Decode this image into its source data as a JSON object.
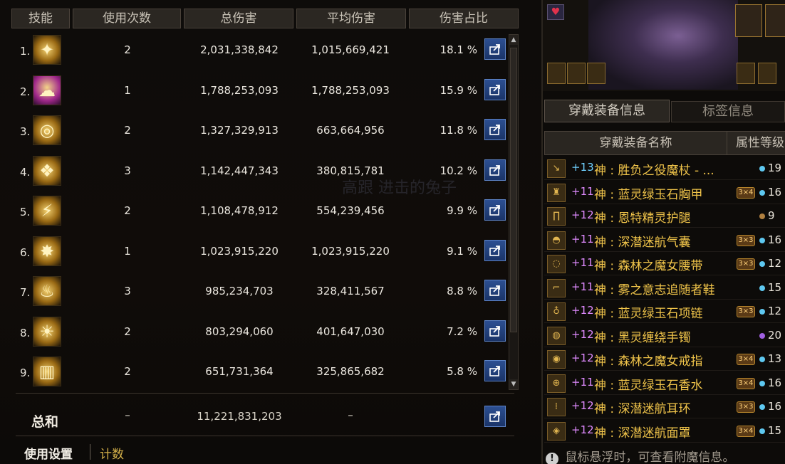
{
  "headers": {
    "skill": "技能",
    "uses": "使用次数",
    "total": "总伤害",
    "avg": "平均伤害",
    "pct": "伤害占比"
  },
  "rows": [
    {
      "num": "1.",
      "uses": "2",
      "total": "2,031,338,842",
      "avg": "1,015,669,421",
      "pct": "18.1 %",
      "icon": "golden-spikes-skill-icon"
    },
    {
      "num": "2.",
      "uses": "1",
      "total": "1,788,253,093",
      "avg": "1,788,253,093",
      "pct": "15.9 %",
      "icon": "purple-burst-skill-icon"
    },
    {
      "num": "3.",
      "uses": "2",
      "total": "1,327,329,913",
      "avg": "663,664,956",
      "pct": "11.8 %",
      "icon": "swirl-skill-icon"
    },
    {
      "num": "4.",
      "uses": "3",
      "total": "1,142,447,343",
      "avg": "380,815,781",
      "pct": "10.2 %",
      "icon": "crystal-skill-icon"
    },
    {
      "num": "5.",
      "uses": "2",
      "total": "1,108,478,912",
      "avg": "554,239,456",
      "pct": "9.9 %",
      "icon": "slash-skill-icon"
    },
    {
      "num": "6.",
      "uses": "1",
      "total": "1,023,915,220",
      "avg": "1,023,915,220",
      "pct": "9.1 %",
      "icon": "explosion-skill-icon"
    },
    {
      "num": "7.",
      "uses": "3",
      "total": "985,234,703",
      "avg": "328,411,567",
      "pct": "8.8 %",
      "icon": "flame-skill-icon"
    },
    {
      "num": "8.",
      "uses": "2",
      "total": "803,294,060",
      "avg": "401,647,030",
      "pct": "7.2 %",
      "icon": "halo-skill-icon"
    },
    {
      "num": "9.",
      "uses": "2",
      "total": "651,731,364",
      "avg": "325,865,682",
      "pct": "5.8 %",
      "icon": "pillars-skill-icon"
    }
  ],
  "totals": {
    "label": "总和",
    "uses": "–",
    "total": "11,221,831,203",
    "avg": "–"
  },
  "bottom_tabs": {
    "settings": "使用设置",
    "count": "计数"
  },
  "watermark": "高跟 进击的兔子",
  "right": {
    "tab_equipped": "穿戴装备信息",
    "tab_tags": "标签信息",
    "col_name": "穿戴装备名称",
    "col_level": "属性等级",
    "hint_icon": "!",
    "hint": "鼠标悬浮时，可查看附魔信息。",
    "equipment": [
      {
        "enhance": "+13",
        "enhance_color": "#6fd0ff",
        "name": "神 : 胜负之役魔杖 - ...",
        "badge": "",
        "dot_color": "#5ec8f0",
        "level": "19",
        "icon": "staff-icon"
      },
      {
        "enhance": "+11",
        "enhance_color": "#e08bff",
        "name": "神 : 蓝灵绿玉石胸甲",
        "badge": "3×4",
        "dot_color": "#5ec8f0",
        "level": "16",
        "icon": "chest-armor-icon"
      },
      {
        "enhance": "+12",
        "enhance_color": "#e08bff",
        "name": "神 : 恩特精灵护腿",
        "badge": "",
        "dot_color": "#b08040",
        "level": "9",
        "icon": "leggings-icon"
      },
      {
        "enhance": "+11",
        "enhance_color": "#e08bff",
        "name": "神 : 深潜迷航气囊",
        "badge": "3×3",
        "dot_color": "#5ec8f0",
        "level": "16",
        "icon": "shoulder-icon"
      },
      {
        "enhance": "+11",
        "enhance_color": "#e08bff",
        "name": "神 : 森林之魔女腰带",
        "badge": "3×3",
        "dot_color": "#5ec8f0",
        "level": "12",
        "icon": "belt-icon"
      },
      {
        "enhance": "+11",
        "enhance_color": "#e08bff",
        "name": "神 : 雾之意志追随者鞋",
        "badge": "",
        "dot_color": "#5ec8f0",
        "level": "15",
        "icon": "boots-icon"
      },
      {
        "enhance": "+12",
        "enhance_color": "#e08bff",
        "name": "神 : 蓝灵绿玉石项链",
        "badge": "3×3",
        "dot_color": "#5ec8f0",
        "level": "12",
        "icon": "necklace-icon"
      },
      {
        "enhance": "+12",
        "enhance_color": "#e08bff",
        "name": "神 : 黑灵缠绕手镯",
        "badge": "",
        "dot_color": "#a060e0",
        "level": "20",
        "icon": "bracelet-icon"
      },
      {
        "enhance": "+12",
        "enhance_color": "#e08bff",
        "name": "神 : 森林之魔女戒指",
        "badge": "3×4",
        "dot_color": "#5ec8f0",
        "level": "13",
        "icon": "ring-icon"
      },
      {
        "enhance": "+11",
        "enhance_color": "#e08bff",
        "name": "神 : 蓝灵绿玉石香水",
        "badge": "3×4",
        "dot_color": "#5ec8f0",
        "level": "16",
        "icon": "perfume-icon"
      },
      {
        "enhance": "+12",
        "enhance_color": "#e08bff",
        "name": "神 : 深潜迷航耳环",
        "badge": "3×3",
        "dot_color": "#5ec8f0",
        "level": "16",
        "icon": "earring-icon"
      },
      {
        "enhance": "+12",
        "enhance_color": "#e08bff",
        "name": "神 : 深潜迷航面罩",
        "badge": "3×4",
        "dot_color": "#5ec8f0",
        "level": "15",
        "icon": "mask-icon"
      }
    ]
  },
  "colors": {
    "gold": "#f0c44a",
    "share_blue": "#2c4f92",
    "purple_enhance": "#e08bff",
    "blue_enhance": "#6fd0ff"
  }
}
